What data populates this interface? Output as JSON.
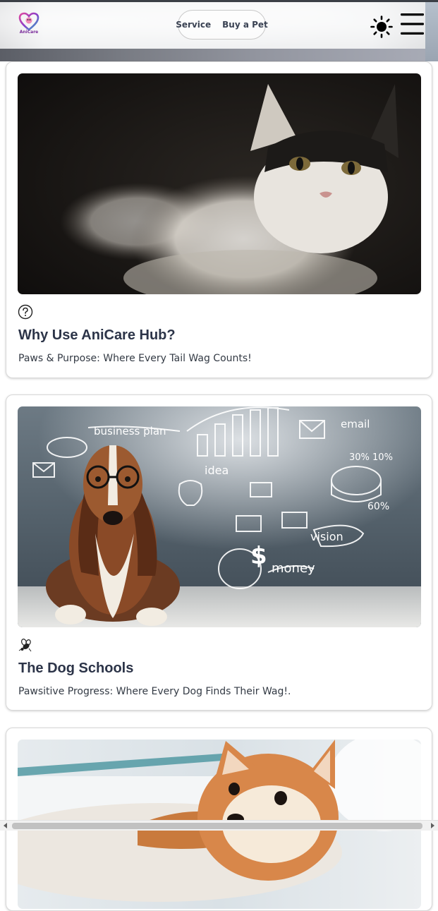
{
  "header": {
    "logo_text": "AniCare",
    "nav": [
      {
        "label": "Service"
      },
      {
        "label": "Buy a Pet"
      }
    ],
    "theme_icon": "sun-icon",
    "menu_icon": "hamburger-menu-icon"
  },
  "cards": [
    {
      "image": "cat-photo",
      "icon": "question-circle-icon",
      "title": "Why Use AniCare Hub?",
      "description": "Paws & Purpose: Where Every Tail Wag Counts!"
    },
    {
      "image": "dog-with-glasses-chalkboard-photo",
      "icon": "bee-icon",
      "title": "The Dog Schools",
      "description": "Pawsitive Progress: Where Every Dog Finds Their Wag!."
    },
    {
      "image": "shiba-puppy-photo",
      "icon": "",
      "title": "",
      "description": ""
    }
  ],
  "colors": {
    "title": "#2c3448",
    "text": "#333a44",
    "logo_accent": "#7a2b9a"
  }
}
